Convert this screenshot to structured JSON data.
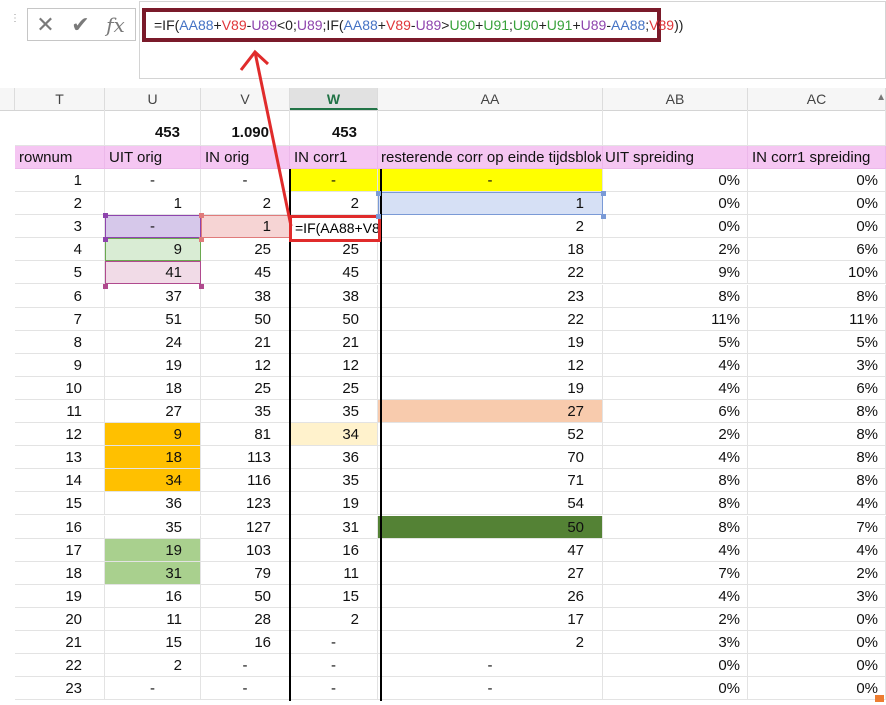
{
  "formula_bar": {
    "cancel_icon": "x-icon",
    "enter_icon": "check-icon",
    "fx_label": "fx",
    "formula_parts": [
      {
        "text": "=IF(",
        "color": "black"
      },
      {
        "text": "AA88",
        "color": "blue"
      },
      {
        "text": "+",
        "color": "black"
      },
      {
        "text": "V89",
        "color": "red"
      },
      {
        "text": "-",
        "color": "black"
      },
      {
        "text": "U89",
        "color": "purple"
      },
      {
        "text": "<0;",
        "color": "black"
      },
      {
        "text": "U89",
        "color": "purple"
      },
      {
        "text": ";IF(",
        "color": "black"
      },
      {
        "text": "AA88",
        "color": "blue"
      },
      {
        "text": "+",
        "color": "black"
      },
      {
        "text": "V89",
        "color": "red"
      },
      {
        "text": "-",
        "color": "black"
      },
      {
        "text": "U89",
        "color": "purple"
      },
      {
        "text": ">",
        "color": "black"
      },
      {
        "text": "U90",
        "color": "green"
      },
      {
        "text": "+",
        "color": "black"
      },
      {
        "text": "U91",
        "color": "green"
      },
      {
        "text": ";",
        "color": "black"
      },
      {
        "text": "U90",
        "color": "green"
      },
      {
        "text": "+",
        "color": "black"
      },
      {
        "text": "U91",
        "color": "green"
      },
      {
        "text": "+",
        "color": "black"
      },
      {
        "text": "U89",
        "color": "purple"
      },
      {
        "text": "-",
        "color": "black"
      },
      {
        "text": "AA88",
        "color": "blue"
      },
      {
        "text": ";",
        "color": "black"
      },
      {
        "text": "V89",
        "color": "red"
      },
      {
        "text": "))",
        "color": "black"
      }
    ]
  },
  "columns": [
    {
      "letter": "T",
      "key": "T"
    },
    {
      "letter": "U",
      "key": "U"
    },
    {
      "letter": "V",
      "key": "V"
    },
    {
      "letter": "W",
      "key": "W",
      "active": true
    },
    {
      "letter": "AA",
      "key": "AA"
    },
    {
      "letter": "AB",
      "key": "AB"
    },
    {
      "letter": "AC",
      "key": "AC"
    }
  ],
  "totals": {
    "U": "453",
    "V": "1.090",
    "W": "453"
  },
  "headers": {
    "T": "rownum",
    "U": "UIT orig",
    "V": "IN orig",
    "W": "IN corr1",
    "AA": "resterende corr op einde tijdsblok",
    "AB": "UIT spreiding",
    "AC": "IN corr1 spreiding"
  },
  "edit_cell_text": "=IF(AA88+V89-U89<0;U89;IF(AA88+V89-U89>U90+U91;U90+U91+U89-AA88;V89))",
  "rows": [
    {
      "T": "1",
      "U": "-",
      "V": "-",
      "W": "-",
      "AA": "-",
      "AB": "0%",
      "AC": "0%",
      "fill": {
        "W": "yellow",
        "AA": "yellow"
      }
    },
    {
      "T": "2",
      "U": "1",
      "V": "2",
      "W": "2",
      "AA": "1",
      "AB": "0%",
      "AC": "0%",
      "fill": {
        "AA": "lblue"
      }
    },
    {
      "T": "3",
      "U": "-",
      "V": "1",
      "W": "",
      "AA": "2",
      "AB": "0%",
      "AC": "0%",
      "fill": {
        "U": "lpurple",
        "V": "lred"
      }
    },
    {
      "T": "4",
      "U": "9",
      "V": "25",
      "W": "25",
      "AA": "18",
      "AB": "2%",
      "AC": "6%",
      "fill": {
        "U": "lgreen"
      }
    },
    {
      "T": "5",
      "U": "41",
      "V": "45",
      "W": "45",
      "AA": "22",
      "AB": "9%",
      "AC": "10%",
      "fill": {
        "U": "lpink"
      }
    },
    {
      "T": "6",
      "U": "37",
      "V": "38",
      "W": "38",
      "AA": "23",
      "AB": "8%",
      "AC": "8%"
    },
    {
      "T": "7",
      "U": "51",
      "V": "50",
      "W": "50",
      "AA": "22",
      "AB": "11%",
      "AC": "11%"
    },
    {
      "T": "8",
      "U": "24",
      "V": "21",
      "W": "21",
      "AA": "19",
      "AB": "5%",
      "AC": "5%"
    },
    {
      "T": "9",
      "U": "19",
      "V": "12",
      "W": "12",
      "AA": "12",
      "AB": "4%",
      "AC": "3%"
    },
    {
      "T": "10",
      "U": "18",
      "V": "25",
      "W": "25",
      "AA": "19",
      "AB": "4%",
      "AC": "6%"
    },
    {
      "T": "11",
      "U": "27",
      "V": "35",
      "W": "35",
      "AA": "27",
      "AB": "6%",
      "AC": "8%",
      "fill": {
        "AA": "salmon"
      }
    },
    {
      "T": "12",
      "U": "9",
      "V": "81",
      "W": "34",
      "AA": "52",
      "AB": "2%",
      "AC": "8%",
      "fill": {
        "U": "orange",
        "W": "cream"
      }
    },
    {
      "T": "13",
      "U": "18",
      "V": "113",
      "W": "36",
      "AA": "70",
      "AB": "4%",
      "AC": "8%",
      "fill": {
        "U": "orange"
      }
    },
    {
      "T": "14",
      "U": "34",
      "V": "116",
      "W": "35",
      "AA": "71",
      "AB": "8%",
      "AC": "8%",
      "fill": {
        "U": "orange"
      }
    },
    {
      "T": "15",
      "U": "36",
      "V": "123",
      "W": "19",
      "AA": "54",
      "AB": "8%",
      "AC": "4%"
    },
    {
      "T": "16",
      "U": "35",
      "V": "127",
      "W": "31",
      "AA": "50",
      "AB": "8%",
      "AC": "7%",
      "fill": {
        "AA": "dkgreen"
      }
    },
    {
      "T": "17",
      "U": "19",
      "V": "103",
      "W": "16",
      "AA": "47",
      "AB": "4%",
      "AC": "4%",
      "fill": {
        "U": "mgreen"
      }
    },
    {
      "T": "18",
      "U": "31",
      "V": "79",
      "W": "11",
      "AA": "27",
      "AB": "7%",
      "AC": "2%",
      "fill": {
        "U": "mgreen"
      }
    },
    {
      "T": "19",
      "U": "16",
      "V": "50",
      "W": "15",
      "AA": "26",
      "AB": "4%",
      "AC": "3%"
    },
    {
      "T": "20",
      "U": "11",
      "V": "28",
      "W": "2",
      "AA": "17",
      "AB": "2%",
      "AC": "0%"
    },
    {
      "T": "21",
      "U": "15",
      "V": "16",
      "W": "-",
      "AA": "2",
      "AB": "3%",
      "AC": "0%"
    },
    {
      "T": "22",
      "U": "2",
      "V": "-",
      "W": "-",
      "AA": "-",
      "AB": "0%",
      "AC": "0%"
    },
    {
      "T": "23",
      "U": "-",
      "V": "-",
      "W": "-",
      "AA": "-",
      "AB": "0%",
      "AC": "0%"
    }
  ],
  "colors": {
    "formula_box_border": "#7a1a2a",
    "highlight_border": "#e02b2b",
    "arrow": "#e02b2b",
    "header_fill": "#f5c6f2"
  }
}
